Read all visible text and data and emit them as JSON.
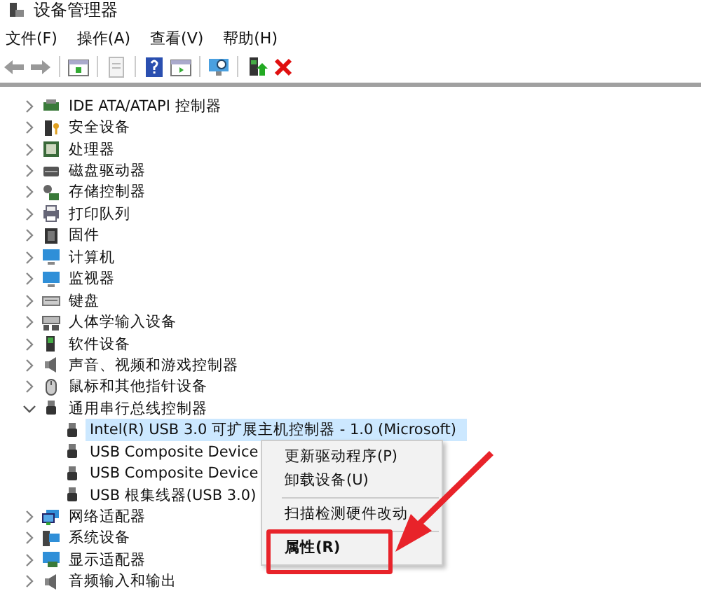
{
  "window": {
    "title": "设备管理器"
  },
  "menu": [
    "文件(F)",
    "操作(A)",
    "查看(V)",
    "帮助(H)"
  ],
  "tree": [
    {
      "label": "IDE ATA/ATAPI 控制器",
      "expanded": false,
      "selected": false
    },
    {
      "label": "安全设备",
      "expanded": false,
      "selected": false
    },
    {
      "label": "处理器",
      "expanded": false,
      "selected": false
    },
    {
      "label": "磁盘驱动器",
      "expanded": false,
      "selected": false
    },
    {
      "label": "存储控制器",
      "expanded": false,
      "selected": false
    },
    {
      "label": "打印队列",
      "expanded": false,
      "selected": false
    },
    {
      "label": "固件",
      "expanded": false,
      "selected": false
    },
    {
      "label": "计算机",
      "expanded": false,
      "selected": false
    },
    {
      "label": "监视器",
      "expanded": false,
      "selected": false
    },
    {
      "label": "键盘",
      "expanded": false,
      "selected": false
    },
    {
      "label": "人体学输入设备",
      "expanded": false,
      "selected": false
    },
    {
      "label": "软件设备",
      "expanded": false,
      "selected": false
    },
    {
      "label": "声音、视频和游戏控制器",
      "expanded": false,
      "selected": false
    },
    {
      "label": "鼠标和其他指针设备",
      "expanded": false,
      "selected": false
    },
    {
      "label": "通用串行总线控制器",
      "expanded": true,
      "selected": false,
      "children": [
        {
          "label": "Intel(R) USB 3.0 可扩展主机控制器 - 1.0 (Microsoft)",
          "selected": true
        },
        {
          "label": "USB Composite Device",
          "selected": false
        },
        {
          "label": "USB Composite Device",
          "selected": false
        },
        {
          "label": "USB 根集线器(USB 3.0)",
          "selected": false
        }
      ]
    },
    {
      "label": "网络适配器",
      "expanded": false,
      "selected": false
    },
    {
      "label": "系统设备",
      "expanded": false,
      "selected": false
    },
    {
      "label": "显示适配器",
      "expanded": false,
      "selected": false
    },
    {
      "label": "音频输入和输出",
      "expanded": false,
      "selected": false
    }
  ],
  "context_menu": [
    {
      "label": "更新驱动程序(P)",
      "bold": false
    },
    {
      "label": "卸载设备(U)",
      "bold": false
    },
    {
      "kind": "separator"
    },
    {
      "label": "扫描检测硬件改动",
      "bold": false
    },
    {
      "kind": "separator"
    },
    {
      "label": "属性(R)",
      "bold": true
    }
  ]
}
